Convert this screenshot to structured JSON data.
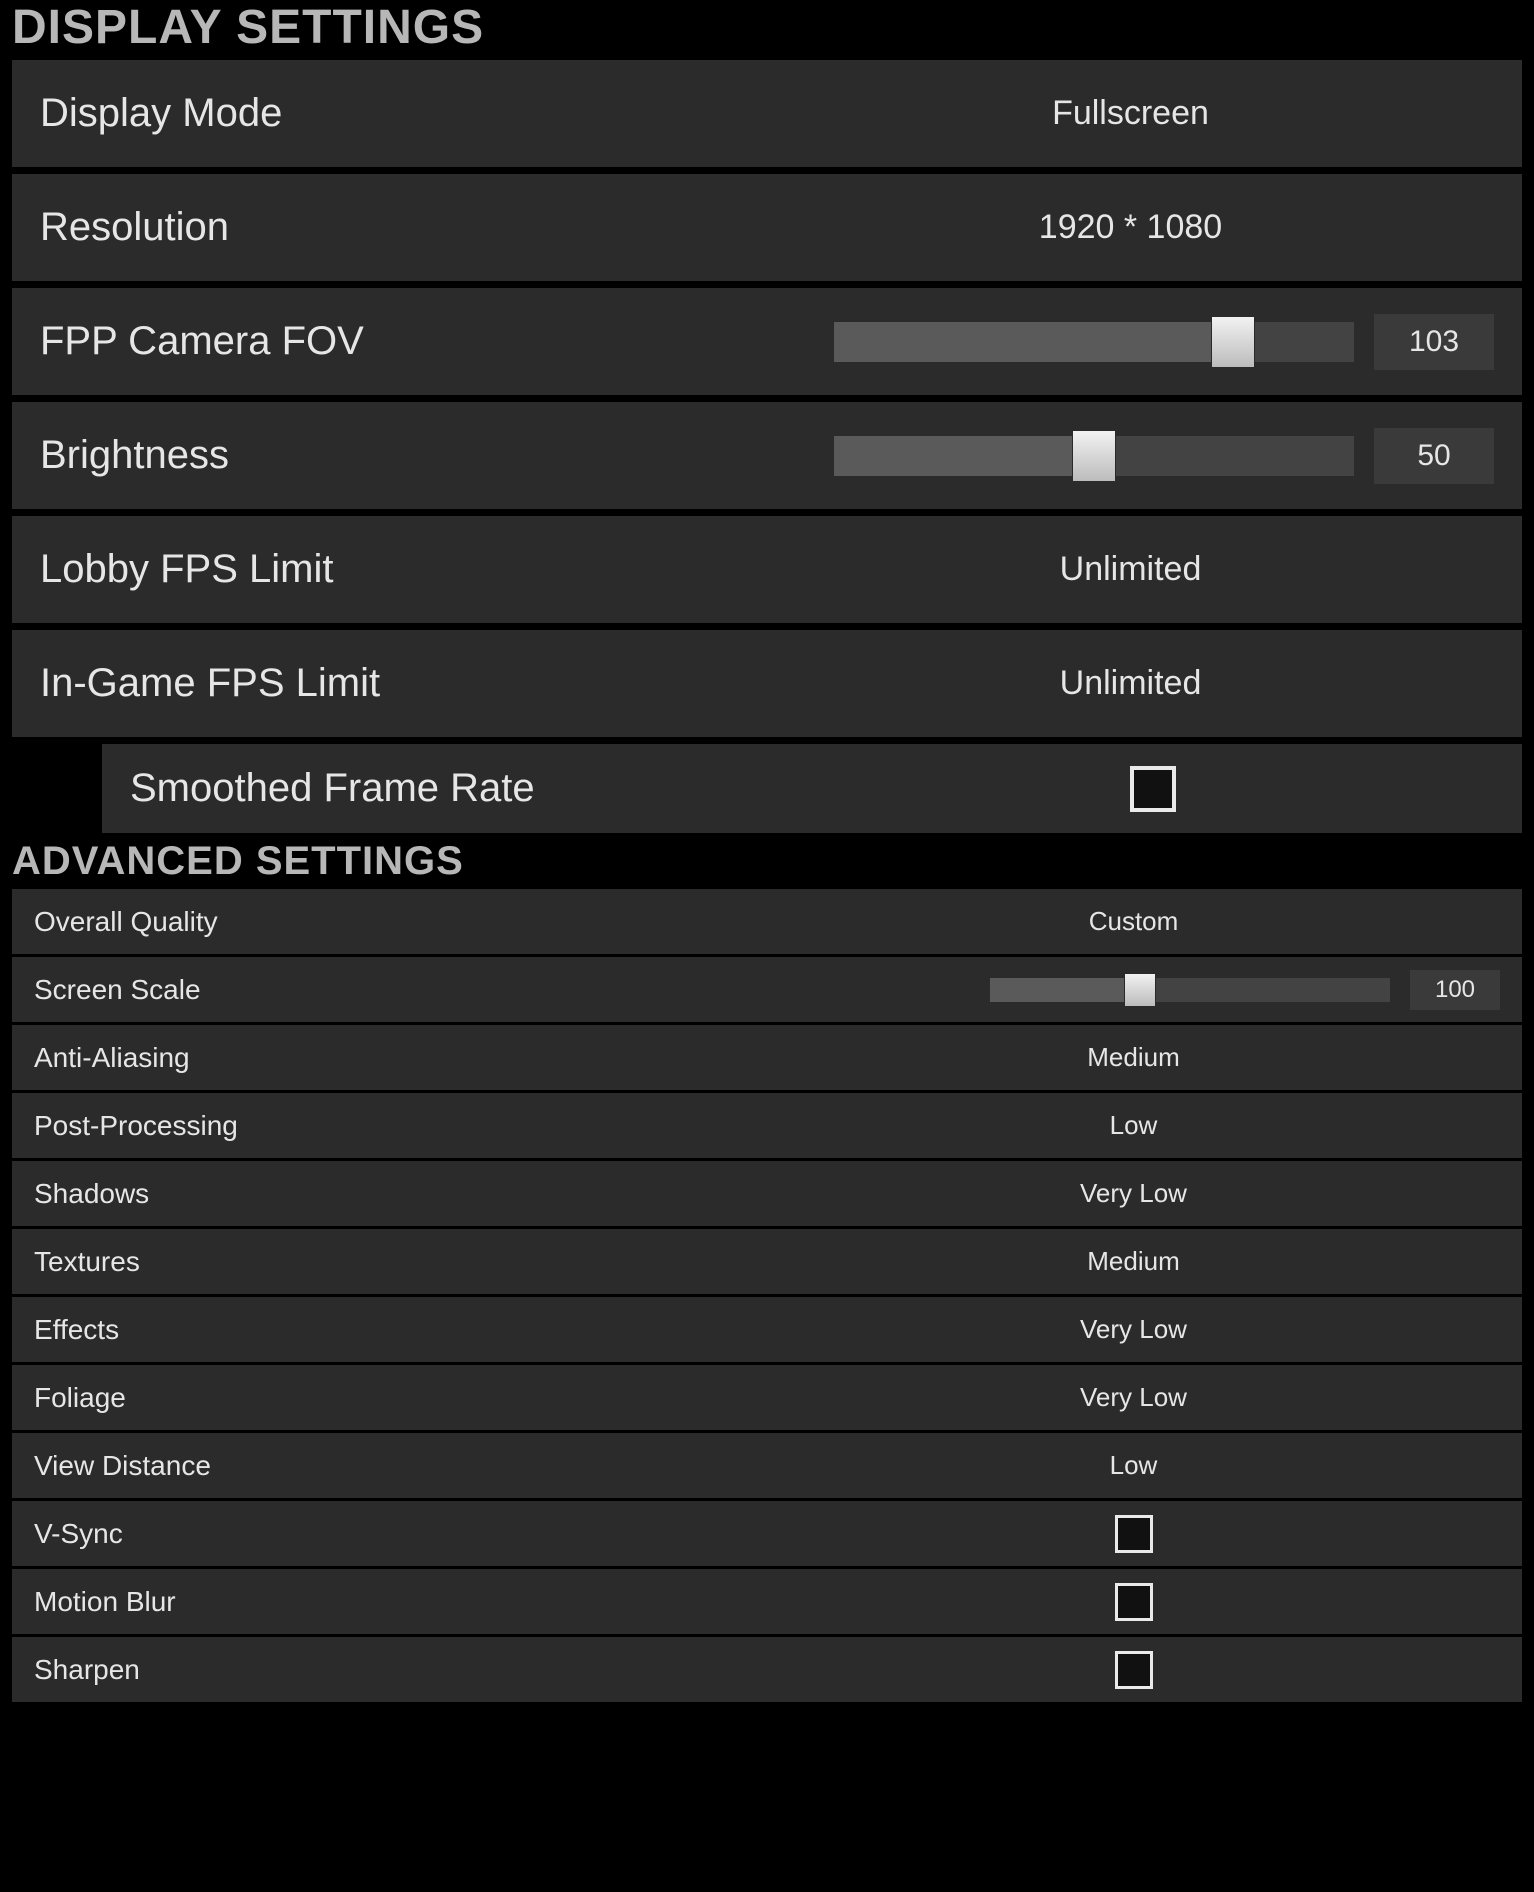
{
  "display": {
    "header": "DISPLAY SETTINGS",
    "display_mode": {
      "label": "Display Mode",
      "value": "Fullscreen"
    },
    "resolution": {
      "label": "Resolution",
      "value": "1920 * 1080"
    },
    "fpp_fov": {
      "label": "FPP Camera FOV",
      "value": 103,
      "min": 80,
      "max": 110
    },
    "brightness": {
      "label": "Brightness",
      "value": 50,
      "min": 0,
      "max": 100
    },
    "lobby_fps": {
      "label": "Lobby FPS Limit",
      "value": "Unlimited"
    },
    "ingame_fps": {
      "label": "In-Game FPS Limit",
      "value": "Unlimited"
    },
    "smoothed_frame_rate": {
      "label": "Smoothed Frame Rate",
      "checked": false
    }
  },
  "advanced": {
    "header": "ADVANCED SETTINGS",
    "overall_quality": {
      "label": "Overall Quality",
      "value": "Custom"
    },
    "screen_scale": {
      "label": "Screen Scale",
      "value": 100,
      "min": 70,
      "max": 150
    },
    "anti_aliasing": {
      "label": "Anti-Aliasing",
      "value": "Medium"
    },
    "post_processing": {
      "label": "Post-Processing",
      "value": "Low"
    },
    "shadows": {
      "label": "Shadows",
      "value": "Very Low"
    },
    "textures": {
      "label": "Textures",
      "value": "Medium"
    },
    "effects": {
      "label": "Effects",
      "value": "Very Low"
    },
    "foliage": {
      "label": "Foliage",
      "value": "Very Low"
    },
    "view_distance": {
      "label": "View Distance",
      "value": "Low"
    },
    "vsync": {
      "label": "V-Sync",
      "checked": false
    },
    "motion_blur": {
      "label": "Motion Blur",
      "checked": false
    },
    "sharpen": {
      "label": "Sharpen",
      "checked": false
    }
  }
}
